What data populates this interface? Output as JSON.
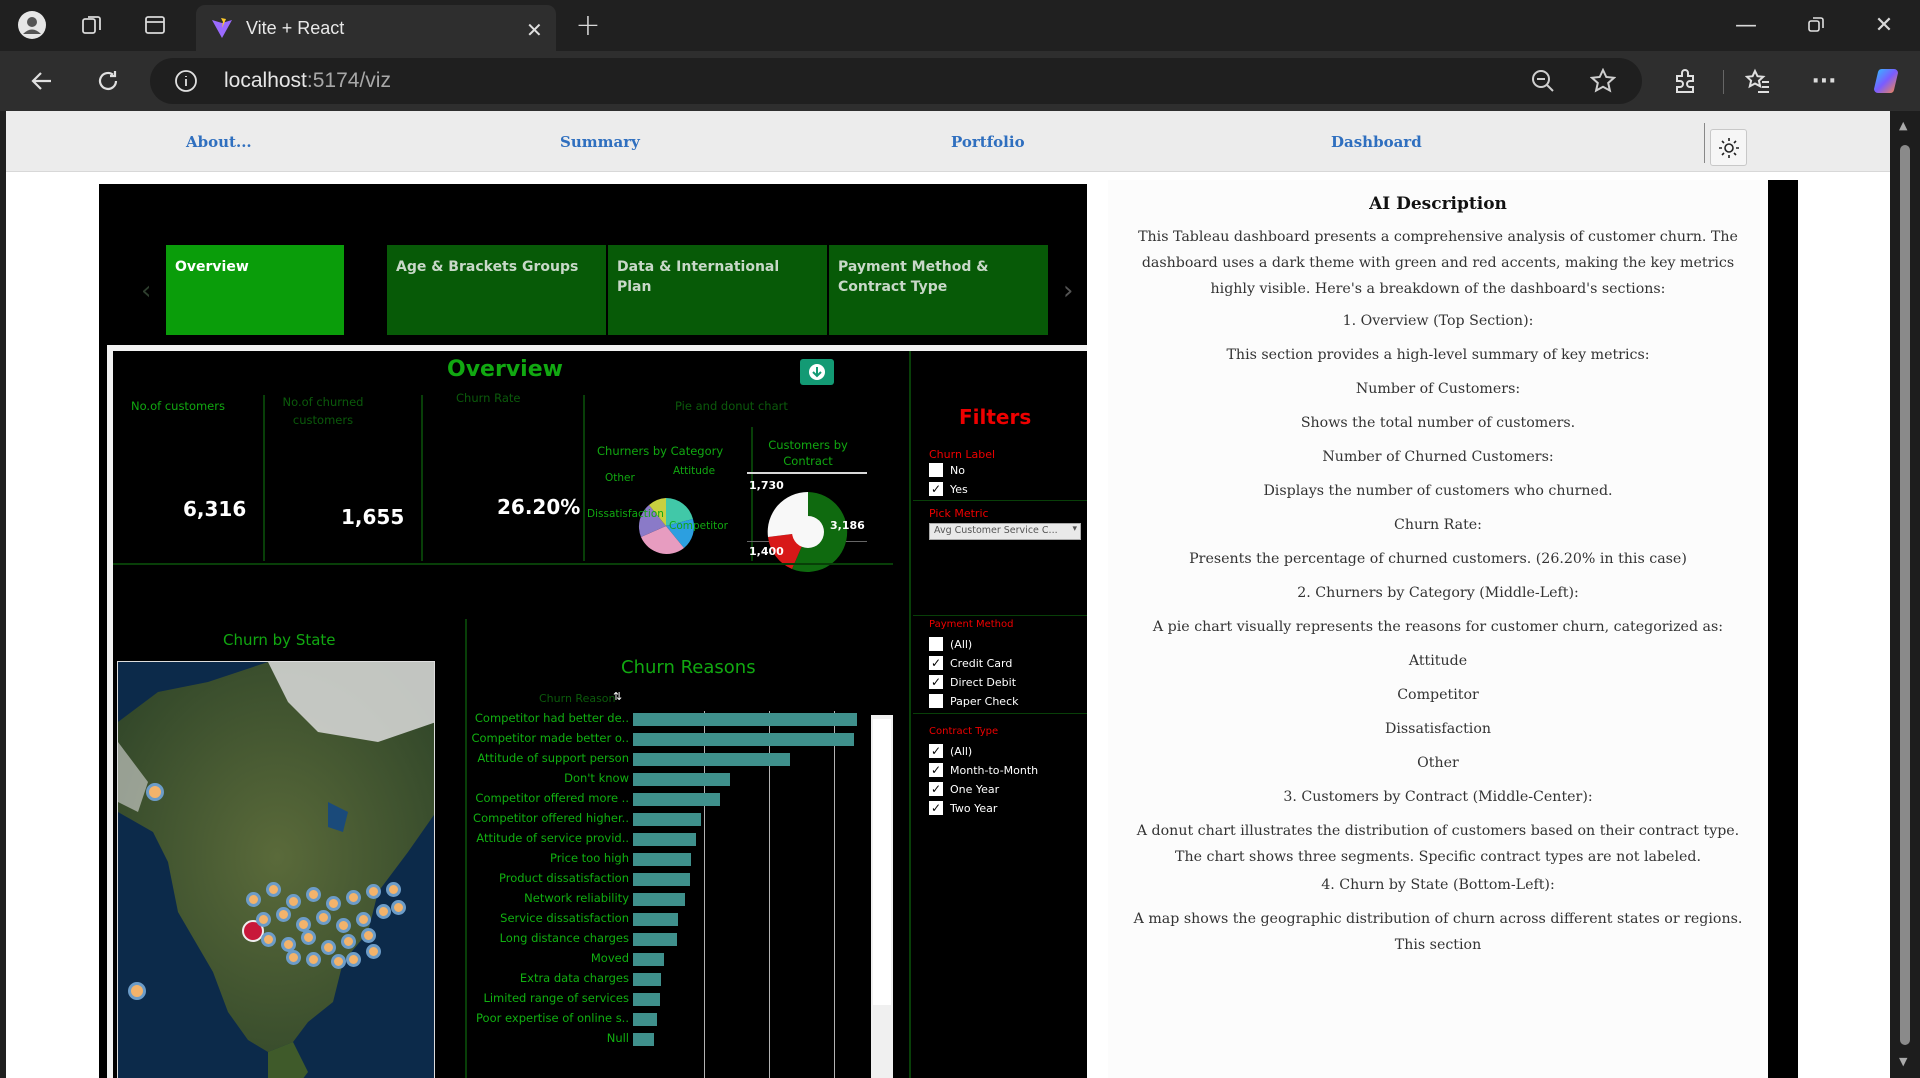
{
  "browser": {
    "tab_title": "Vite + React",
    "url_host": "localhost",
    "url_rest": ":5174/viz"
  },
  "nav": {
    "links": [
      "About...",
      "Summary",
      "Portfolio",
      "Dashboard"
    ]
  },
  "tableau": {
    "tabs": [
      "Overview",
      "Age & Brackets Groups",
      "Data & International Plan",
      "Payment Method & Contract Type"
    ],
    "overview_title": "Overview",
    "kpi_labels": {
      "customers": "No.of customers",
      "churned_line1": "No.of churned",
      "churned_line2": "customers",
      "churn_rate": "Churn Rate",
      "pie_section": "Pie and donut chart"
    },
    "kpis": {
      "customers": "6,316",
      "churned": "1,655",
      "churn_rate": "26.20%"
    },
    "churners_by_category": {
      "title": "Churners by Category",
      "labels": [
        "Other",
        "Attitude",
        "Dissatisfaction",
        "Competitor"
      ]
    },
    "customers_by_contract": {
      "title_line1": "Customers by",
      "title_line2": "Contract",
      "labels": [
        "1,730",
        "3,186",
        "1,400"
      ]
    },
    "filters": {
      "title": "Filters",
      "churn_label": {
        "title": "Churn Label",
        "options": [
          {
            "label": "No",
            "checked": false
          },
          {
            "label": "Yes",
            "checked": true
          }
        ]
      },
      "pick_metric": {
        "title": "Pick Metric",
        "value": "Avg Customer Service C..."
      },
      "payment_method": {
        "title": "Payment Method",
        "options": [
          {
            "label": "(All)",
            "checked": false
          },
          {
            "label": "Credit Card",
            "checked": true
          },
          {
            "label": "Direct Debit",
            "checked": true
          },
          {
            "label": "Paper Check",
            "checked": false
          }
        ]
      },
      "contract_type": {
        "title": "Contract Type",
        "options": [
          {
            "label": "(All)",
            "checked": true
          },
          {
            "label": "Month-to-Month",
            "checked": true
          },
          {
            "label": "One Year",
            "checked": true
          },
          {
            "label": "Two Year",
            "checked": true
          }
        ]
      }
    },
    "churn_by_state": {
      "title": "Churn by State"
    },
    "churn_reasons": {
      "title": "Churn Reasons",
      "header": "Churn Reason",
      "chart_data": {
        "type": "bar",
        "orientation": "horizontal",
        "categories": [
          "Competitor had better de..",
          "Competitor made better o..",
          "Attitude of support person",
          "Don't know",
          "Competitor offered more ..",
          "Competitor offered higher..",
          "Attitude of service provid..",
          "Price too high",
          "Product dissatisfaction",
          "Network reliability",
          "Service dissatisfaction",
          "Long distance charges",
          "Moved",
          "Extra data charges",
          "Limited range of services",
          "Poor expertise of online s..",
          "Null"
        ],
        "values": [
          225,
          222,
          158,
          97,
          87,
          68,
          63,
          58,
          57,
          52,
          45,
          44,
          31,
          28,
          27,
          24,
          21
        ]
      }
    }
  },
  "description": {
    "title": "AI Description",
    "paragraphs": [
      "This Tableau dashboard presents a comprehensive analysis of customer churn. The dashboard uses a dark theme with green and red accents, making the key metrics highly visible.  Here's a breakdown of the dashboard's sections:",
      "1. Overview (Top Section):",
      "This section provides a high-level summary of key metrics:",
      "Number of Customers:",
      "Shows the total number of customers.",
      "Number of Churned Customers:",
      "Displays the number of customers who churned.",
      "Churn Rate:",
      "Presents the percentage of churned customers. (26.20% in this case)",
      "2. Churners by Category (Middle-Left):",
      "A pie chart visually represents the reasons for customer churn, categorized as:",
      "Attitude",
      "Competitor",
      "Dissatisfaction",
      "Other",
      "3. Customers by Contract (Middle-Center):",
      "A donut chart illustrates the distribution of customers based on their contract type. The chart shows three segments. Specific contract types are not labeled.",
      "4. Churn by State (Bottom-Left):",
      "A map shows the geographic distribution of churn across different states or regions. This section"
    ]
  }
}
